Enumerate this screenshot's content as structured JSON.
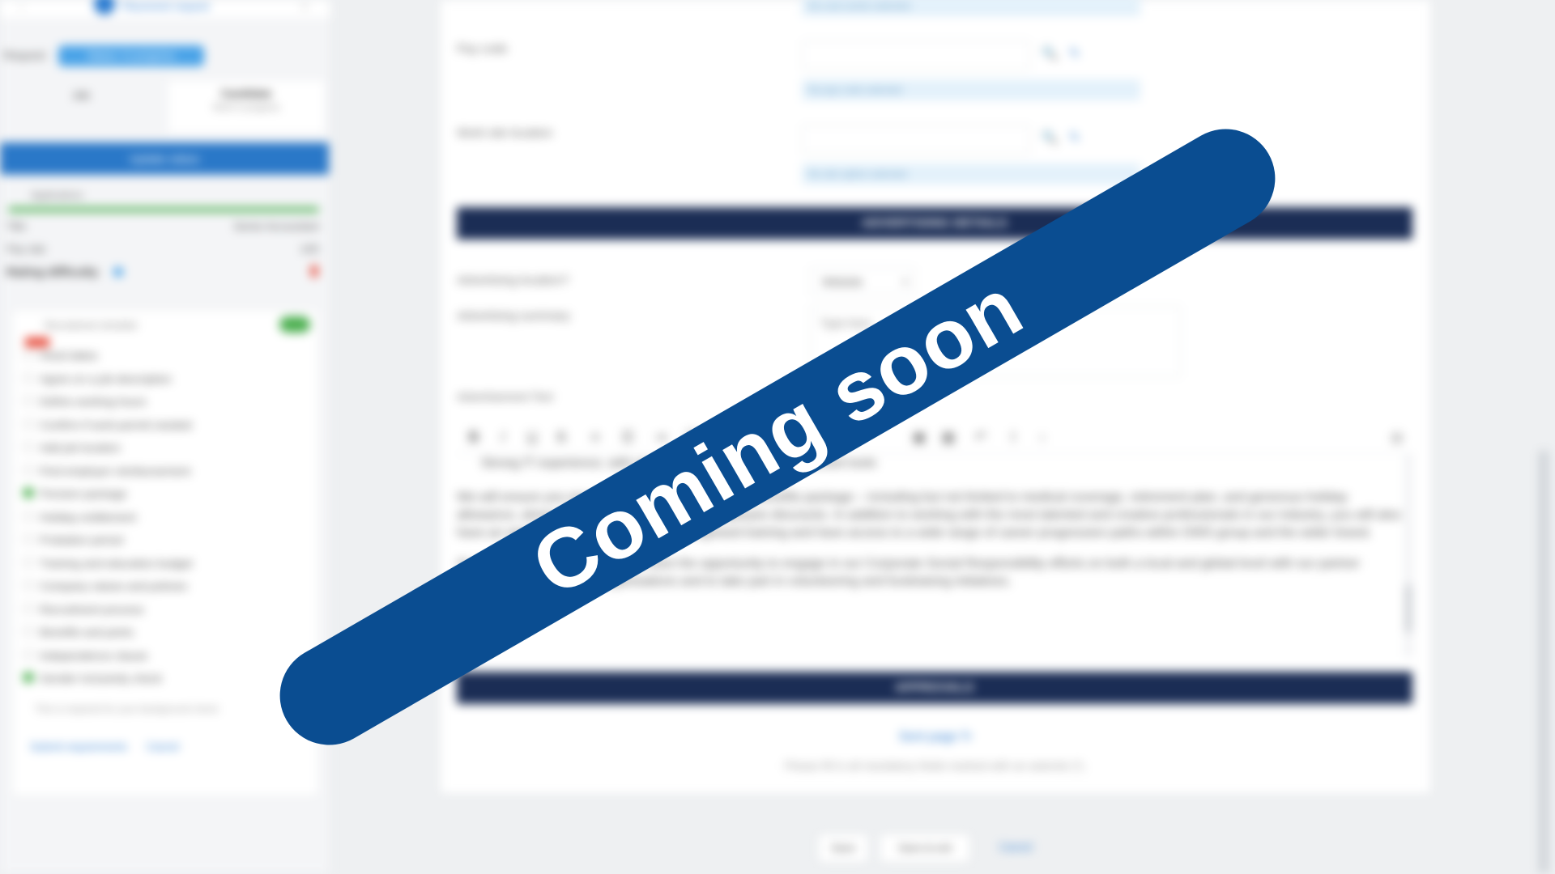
{
  "sidebar": {
    "back_glyph": "‹",
    "close_glyph": "×",
    "candidate_name": "Placement request",
    "request_label": "Request",
    "request_badge": "Status: In progress",
    "tabs": [
      {
        "label": "Job"
      },
      {
        "label": "Candidate",
        "sub": "Work in progress"
      }
    ],
    "update_button": "Update status",
    "progress_label": "Applications",
    "progress_pct": 100,
    "rows": [
      {
        "key": "Title",
        "value": "Senior Accountant"
      },
      {
        "key": "Pay rate",
        "value": "£45"
      }
    ],
    "rating_label": "Rating difficulty",
    "checklist": {
      "header": "Recruitment checklist",
      "items": [
        {
          "label": "Hired dates",
          "done": false
        },
        {
          "label": "Agree on a job description",
          "done": false
        },
        {
          "label": "Define working hours",
          "done": false
        },
        {
          "label": "Confirm if work-permit needed",
          "done": false
        },
        {
          "label": "Add job location",
          "done": false
        },
        {
          "label": "Find employer reimbursement",
          "done": false
        },
        {
          "label": "Pension package",
          "done": true
        },
        {
          "label": "Holiday entitlement",
          "done": false
        },
        {
          "label": "Probation period",
          "done": false
        },
        {
          "label": "Training and education budget",
          "done": false
        },
        {
          "label": "Company values and policies",
          "done": false
        },
        {
          "label": "Recruitment process",
          "done": false
        },
        {
          "label": "Benefits and perks",
          "done": false
        },
        {
          "label": "Independence clause",
          "done": false
        },
        {
          "label": "Gender inclusivity check",
          "done": true
        }
      ],
      "note": "This is required for your background check",
      "links": [
        "Submit requirements",
        "Cancel"
      ]
    }
  },
  "form": {
    "fields": [
      {
        "label": "Pay code",
        "note": "No pay code selected"
      },
      {
        "label": "Work site location",
        "note": "No site option selected"
      }
    ],
    "top_note": "No cost centre selected",
    "advertising_section": "ADVERTISING DETAILS",
    "advertising_q": "Advertising location?",
    "advertising_q_value": "Website",
    "advertising_summary_label": "Advertising summary",
    "advertising_summary_placeholder": "Type here",
    "advertisement_text_label": "Advertisement Text",
    "editor": {
      "bullet": "Strong IT experience, with exposure to cloud and other relevant tools",
      "paragraphs": [
        "We will ensure you are rewarded with a competitive benefits package – including but not limited to medical coverage, retirement plan, and generous holiday allowance, along with gym membership and employee discounts. In addition to working with the most talented and creative professionals in our industry, you will also have an opportunity to attend industry-recognised training and have access to a wide range of career progression paths within OWS group and the wider brand.",
        "As part of your role, you will also have the opportunity to engage in our Corporate Social Responsibility efforts on both a local and global level with our partner charities and community organisations and to take part in volunteering and fundraising initiatives."
      ]
    },
    "approvals_section": "APPROVALS",
    "sign_link": "Sent page ↻",
    "sign_note": "Please fill in all mandatory fields marked with an asterisk (*)."
  },
  "footer": {
    "buttons": [
      "Save",
      "Save & exit",
      "Cancel"
    ]
  },
  "banner": {
    "text": "Coming soon",
    "color": "#0a4d91"
  },
  "icons": {
    "search": "🔍",
    "edit": "✎"
  }
}
